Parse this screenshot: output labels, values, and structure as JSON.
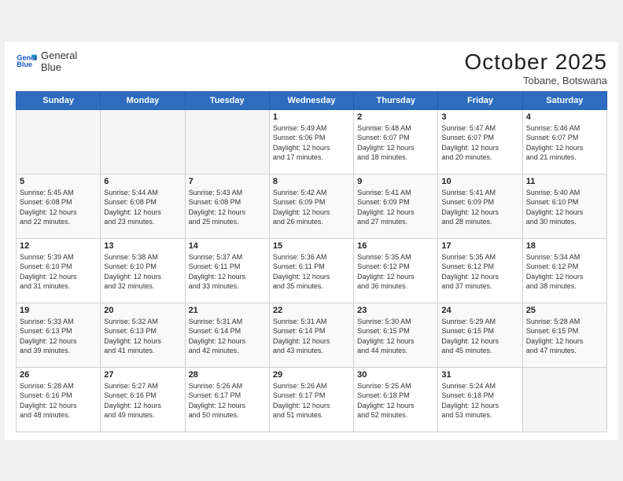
{
  "header": {
    "logo_line1": "General",
    "logo_line2": "Blue",
    "month": "October 2025",
    "location": "Tobane, Botswana"
  },
  "weekdays": [
    "Sunday",
    "Monday",
    "Tuesday",
    "Wednesday",
    "Thursday",
    "Friday",
    "Saturday"
  ],
  "weeks": [
    [
      {
        "day": "",
        "info": ""
      },
      {
        "day": "",
        "info": ""
      },
      {
        "day": "",
        "info": ""
      },
      {
        "day": "1",
        "info": "Sunrise: 5:49 AM\nSunset: 6:06 PM\nDaylight: 12 hours\nand 17 minutes."
      },
      {
        "day": "2",
        "info": "Sunrise: 5:48 AM\nSunset: 6:07 PM\nDaylight: 12 hours\nand 18 minutes."
      },
      {
        "day": "3",
        "info": "Sunrise: 5:47 AM\nSunset: 6:07 PM\nDaylight: 12 hours\nand 20 minutes."
      },
      {
        "day": "4",
        "info": "Sunrise: 5:46 AM\nSunset: 6:07 PM\nDaylight: 12 hours\nand 21 minutes."
      }
    ],
    [
      {
        "day": "5",
        "info": "Sunrise: 5:45 AM\nSunset: 6:08 PM\nDaylight: 12 hours\nand 22 minutes."
      },
      {
        "day": "6",
        "info": "Sunrise: 5:44 AM\nSunset: 6:08 PM\nDaylight: 12 hours\nand 23 minutes."
      },
      {
        "day": "7",
        "info": "Sunrise: 5:43 AM\nSunset: 6:08 PM\nDaylight: 12 hours\nand 25 minutes."
      },
      {
        "day": "8",
        "info": "Sunrise: 5:42 AM\nSunset: 6:09 PM\nDaylight: 12 hours\nand 26 minutes."
      },
      {
        "day": "9",
        "info": "Sunrise: 5:41 AM\nSunset: 6:09 PM\nDaylight: 12 hours\nand 27 minutes."
      },
      {
        "day": "10",
        "info": "Sunrise: 5:41 AM\nSunset: 6:09 PM\nDaylight: 12 hours\nand 28 minutes."
      },
      {
        "day": "11",
        "info": "Sunrise: 5:40 AM\nSunset: 6:10 PM\nDaylight: 12 hours\nand 30 minutes."
      }
    ],
    [
      {
        "day": "12",
        "info": "Sunrise: 5:39 AM\nSunset: 6:10 PM\nDaylight: 12 hours\nand 31 minutes."
      },
      {
        "day": "13",
        "info": "Sunrise: 5:38 AM\nSunset: 6:10 PM\nDaylight: 12 hours\nand 32 minutes."
      },
      {
        "day": "14",
        "info": "Sunrise: 5:37 AM\nSunset: 6:11 PM\nDaylight: 12 hours\nand 33 minutes."
      },
      {
        "day": "15",
        "info": "Sunrise: 5:36 AM\nSunset: 6:11 PM\nDaylight: 12 hours\nand 35 minutes."
      },
      {
        "day": "16",
        "info": "Sunrise: 5:35 AM\nSunset: 6:12 PM\nDaylight: 12 hours\nand 36 minutes."
      },
      {
        "day": "17",
        "info": "Sunrise: 5:35 AM\nSunset: 6:12 PM\nDaylight: 12 hours\nand 37 minutes."
      },
      {
        "day": "18",
        "info": "Sunrise: 5:34 AM\nSunset: 6:12 PM\nDaylight: 12 hours\nand 38 minutes."
      }
    ],
    [
      {
        "day": "19",
        "info": "Sunrise: 5:33 AM\nSunset: 6:13 PM\nDaylight: 12 hours\nand 39 minutes."
      },
      {
        "day": "20",
        "info": "Sunrise: 5:32 AM\nSunset: 6:13 PM\nDaylight: 12 hours\nand 41 minutes."
      },
      {
        "day": "21",
        "info": "Sunrise: 5:31 AM\nSunset: 6:14 PM\nDaylight: 12 hours\nand 42 minutes."
      },
      {
        "day": "22",
        "info": "Sunrise: 5:31 AM\nSunset: 6:14 PM\nDaylight: 12 hours\nand 43 minutes."
      },
      {
        "day": "23",
        "info": "Sunrise: 5:30 AM\nSunset: 6:15 PM\nDaylight: 12 hours\nand 44 minutes."
      },
      {
        "day": "24",
        "info": "Sunrise: 5:29 AM\nSunset: 6:15 PM\nDaylight: 12 hours\nand 45 minutes."
      },
      {
        "day": "25",
        "info": "Sunrise: 5:28 AM\nSunset: 6:15 PM\nDaylight: 12 hours\nand 47 minutes."
      }
    ],
    [
      {
        "day": "26",
        "info": "Sunrise: 5:28 AM\nSunset: 6:16 PM\nDaylight: 12 hours\nand 48 minutes."
      },
      {
        "day": "27",
        "info": "Sunrise: 5:27 AM\nSunset: 6:16 PM\nDaylight: 12 hours\nand 49 minutes."
      },
      {
        "day": "28",
        "info": "Sunrise: 5:26 AM\nSunset: 6:17 PM\nDaylight: 12 hours\nand 50 minutes."
      },
      {
        "day": "29",
        "info": "Sunrise: 5:26 AM\nSunset: 6:17 PM\nDaylight: 12 hours\nand 51 minutes."
      },
      {
        "day": "30",
        "info": "Sunrise: 5:25 AM\nSunset: 6:18 PM\nDaylight: 12 hours\nand 52 minutes."
      },
      {
        "day": "31",
        "info": "Sunrise: 5:24 AM\nSunset: 6:18 PM\nDaylight: 12 hours\nand 53 minutes."
      },
      {
        "day": "",
        "info": ""
      }
    ]
  ]
}
